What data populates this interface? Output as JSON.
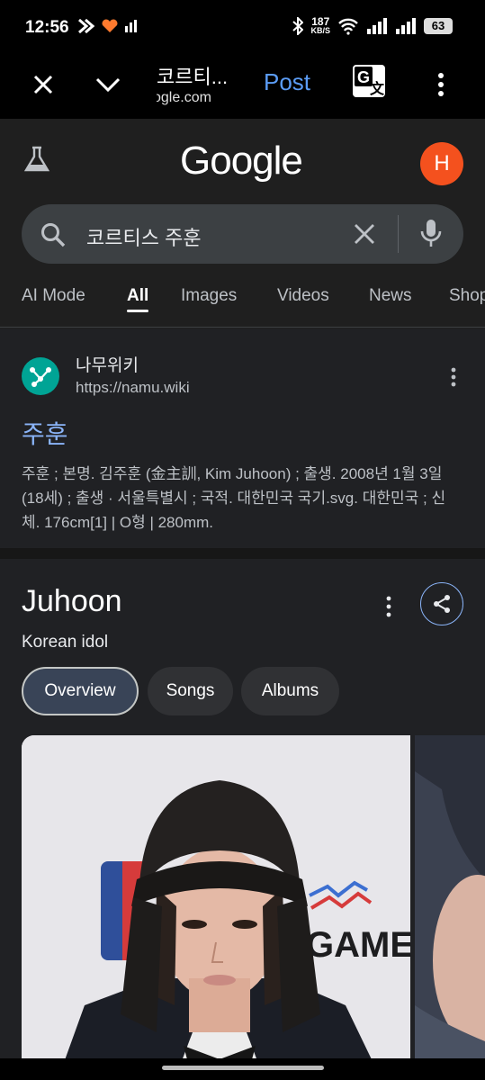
{
  "status": {
    "time": "12:56",
    "speed_value": "187",
    "speed_unit": "KB/S",
    "battery": "63"
  },
  "toolbar": {
    "title": "코르티...",
    "url": "ogle.com",
    "post_label": "Post"
  },
  "google": {
    "logo": "Google",
    "avatar_letter": "H"
  },
  "search": {
    "query": "코르티스 주훈"
  },
  "tabs": [
    {
      "label": "AI Mode"
    },
    {
      "label": "All"
    },
    {
      "label": "Images"
    },
    {
      "label": "Videos"
    },
    {
      "label": "News"
    },
    {
      "label": "Shop"
    }
  ],
  "result": {
    "site_name": "나무위키",
    "site_url": "https://namu.wiki",
    "title": "주훈",
    "snippet": "주훈 ; 본명. 김주훈 (金主訓, Kim Juhoon) ; 출생. 2008년 1월 3일 (18세) ; 출생 · 서울특별시 ; 국적. 대한민국 국기.svg. 대한민국 ; 신체. 176cm[1] | O형 | 280mm."
  },
  "knowledge_panel": {
    "title": "Juhoon",
    "subtitle": "Korean idol",
    "chips": [
      {
        "label": "Overview"
      },
      {
        "label": "Songs"
      },
      {
        "label": "Albums"
      }
    ],
    "image_text": "GAME"
  },
  "icons": {
    "close": "close-icon",
    "chevron": "chevron-down-icon",
    "translate": "translate-icon",
    "more": "more-vert-icon",
    "flask": "flask-icon",
    "search": "search-icon",
    "clear": "clear-icon",
    "mic": "mic-icon",
    "share": "share-icon"
  }
}
